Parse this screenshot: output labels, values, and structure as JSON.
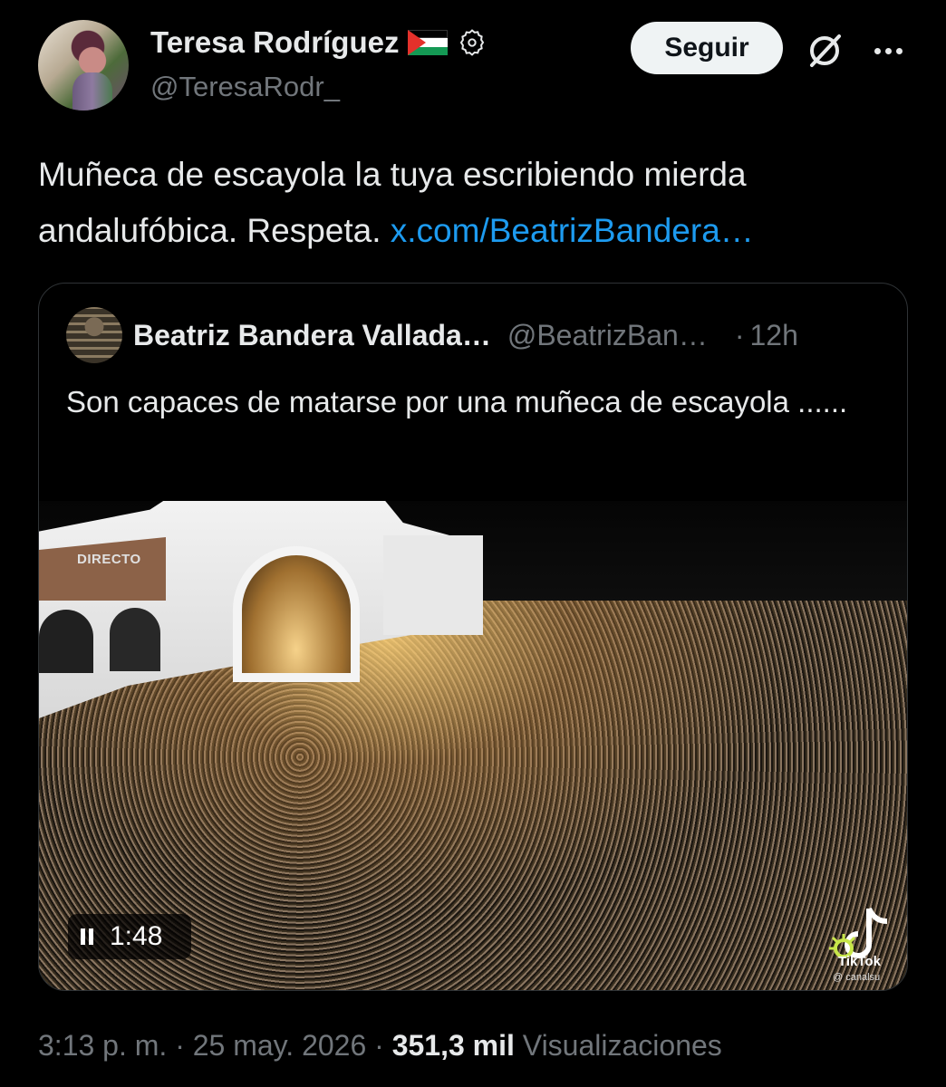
{
  "author": {
    "name": "Teresa Rodríguez",
    "handle": "@TeresaRodr_"
  },
  "actions": {
    "follow_label": "Seguir"
  },
  "tweet": {
    "text": "Muñeca de escayola la tuya escribiendo mierda andalufóbica. Respeta. ",
    "link": "x.com/BeatrizBandera…"
  },
  "quote": {
    "name": "Beatriz Bandera Vallada…",
    "handle": "@BeatrizBan…",
    "dot": "·",
    "time": "12h",
    "text": "Son capaces de matarse por una muñeca de escayola ......",
    "video": {
      "duration": "1:48",
      "overlay_label": "DIRECTO",
      "watermark": "TikTok",
      "watermark_user": "@ canalsu"
    }
  },
  "footer": {
    "timestamp": "3:13 p. m. · 25 may. 2026 · ",
    "views_count": "351,3 mil",
    "views_label": " Visualizaciones"
  },
  "colors": {
    "background": "#000000",
    "text": "#e7e9ea",
    "muted": "#71767b",
    "link": "#1d9bf0",
    "border": "#2f3336"
  }
}
